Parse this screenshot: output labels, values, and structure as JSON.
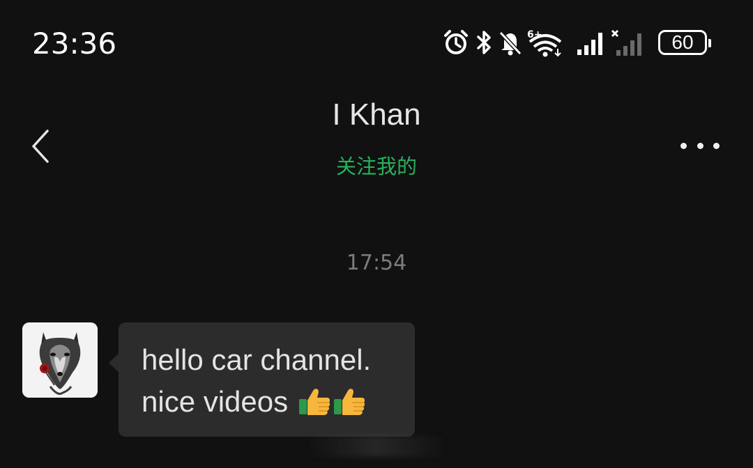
{
  "status_bar": {
    "time": "23:36",
    "battery_level": "60",
    "icons": [
      "alarm-icon",
      "bluetooth-icon",
      "mute-bell-icon",
      "wifi-6-icon",
      "signal-icon",
      "no-signal-icon",
      "battery-icon"
    ]
  },
  "header": {
    "back_icon": "chevron-left-icon",
    "contact_name": "I Khan",
    "contact_subtitle": "关注我的",
    "more_icon": "more-dots-icon",
    "accent_color": "#27b15e"
  },
  "chat": {
    "timestamp": "17:54",
    "messages": [
      {
        "sender": "incoming",
        "avatar": "wolf-avatar",
        "lines": [
          "hello car channel.",
          "nice videos"
        ],
        "emoji": [
          "thumbs-up",
          "thumbs-up"
        ]
      }
    ]
  }
}
